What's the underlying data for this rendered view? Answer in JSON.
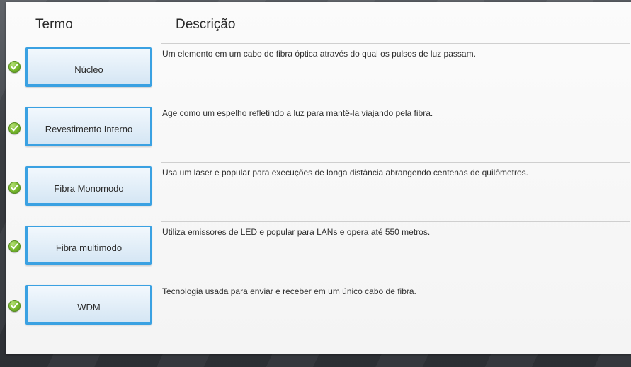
{
  "headers": {
    "term": "Termo",
    "description": "Descrição"
  },
  "rows": [
    {
      "term": "Núcleo",
      "description": "Um elemento em um cabo de fibra óptica através do qual os pulsos de luz passam.",
      "status": "correct"
    },
    {
      "term": "Revestimento Interno",
      "description": "Age como um espelho refletindo a luz para mantê-la viajando pela fibra.",
      "status": "correct"
    },
    {
      "term": "Fibra Monomodo",
      "description": "Usa um laser e popular para execuções de longa distância abrangendo centenas de quilômetros.",
      "status": "correct"
    },
    {
      "term": "Fibra multimodo",
      "description": "Utiliza emissores de LED e popular para LANs e opera até 550 metros.",
      "status": "correct"
    },
    {
      "term": "WDM",
      "description": "Tecnologia usada para enviar e receber em um único cabo de fibra.",
      "status": "correct"
    }
  ],
  "colors": {
    "accent_border": "#3aa1e2",
    "check_green": "#7bbb2e"
  },
  "icons": {
    "status": "check-circle-icon"
  }
}
